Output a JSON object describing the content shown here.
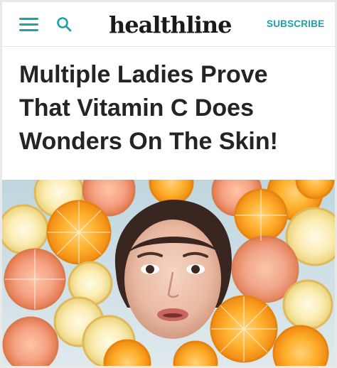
{
  "header": {
    "logo_text": "healthline",
    "subscribe_label": "SUBSCRIBE",
    "menu_icon": "hamburger-menu-icon",
    "search_icon": "search-icon",
    "accent_color": "#1aa4a9"
  },
  "article": {
    "headline_lines": [
      "Multiple Ladies Prove",
      "That Vitamin C Does",
      "Wonders On The Skin!"
    ]
  }
}
